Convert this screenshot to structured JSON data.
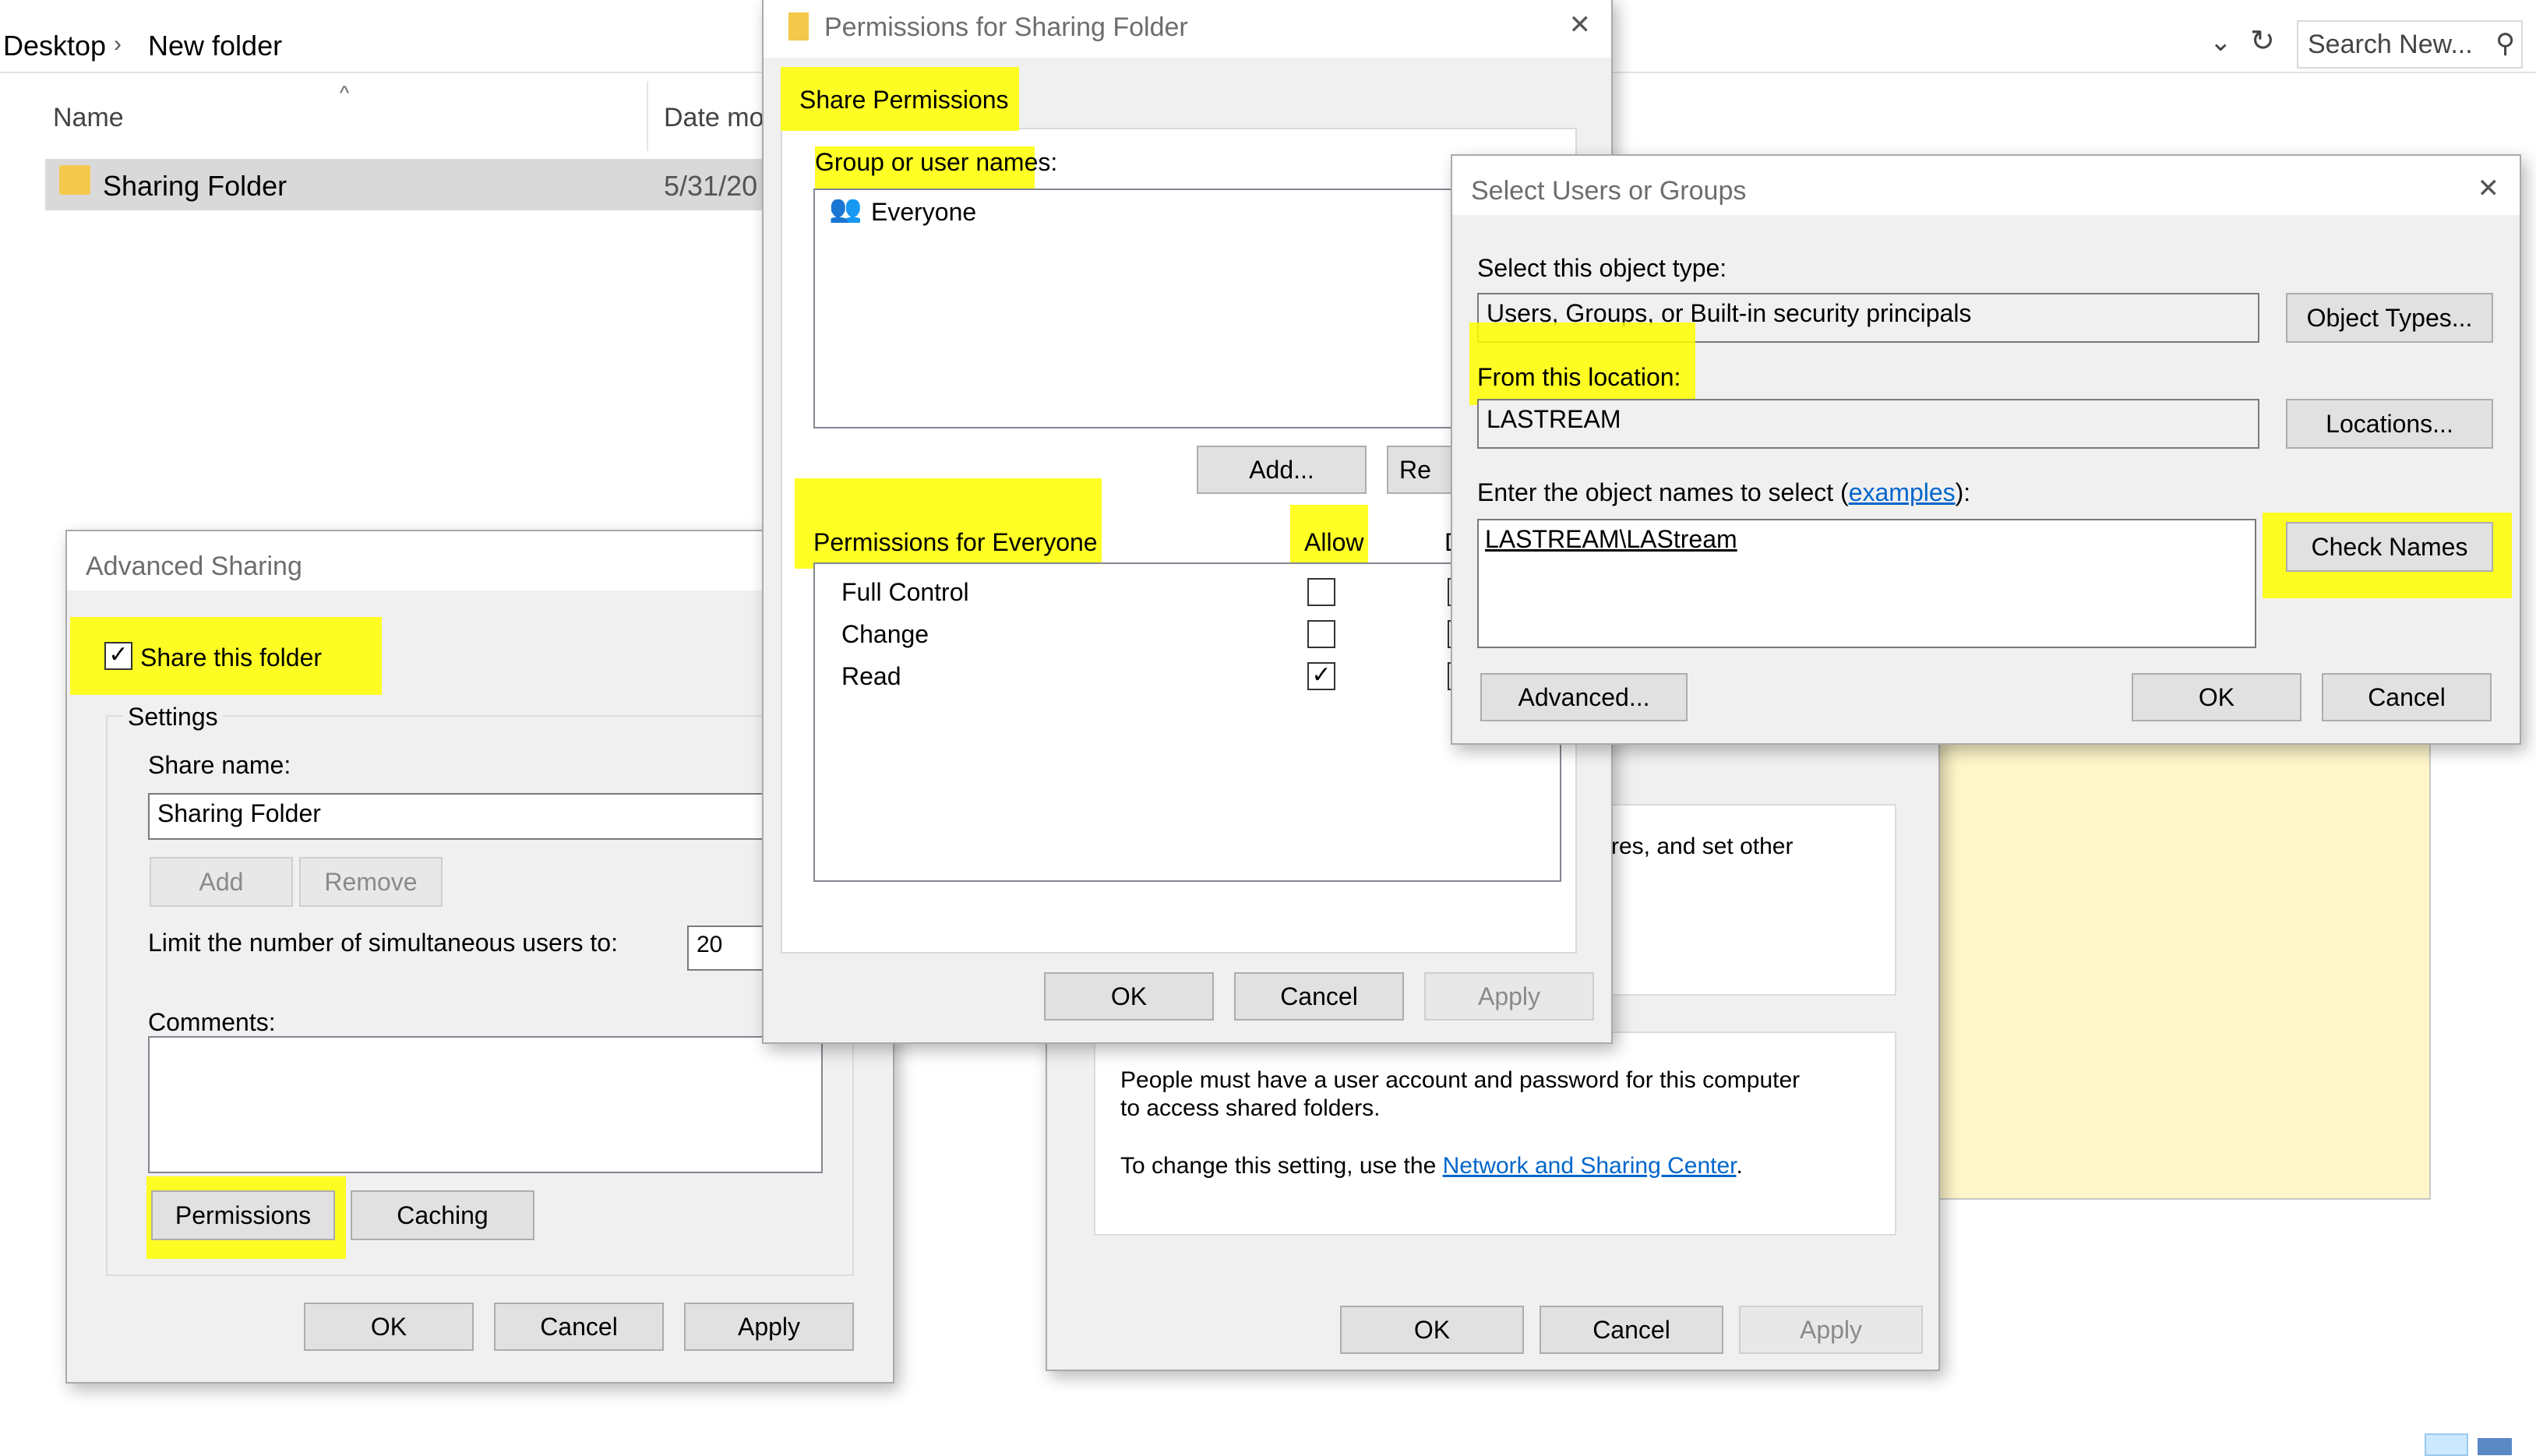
{
  "explorer": {
    "breadcrumb": [
      "Desktop",
      "New folder"
    ],
    "search_placeholder": "Search New...",
    "columns": {
      "name": "Name",
      "date": "Date mo"
    },
    "row": {
      "name": "Sharing Folder",
      "date": "5/31/20"
    }
  },
  "advanced_sharing": {
    "title": "Advanced Sharing",
    "share_label": "Share this folder",
    "settings_label": "Settings",
    "share_name_label": "Share name:",
    "share_name_value": "Sharing Folder",
    "add": "Add",
    "remove": "Remove",
    "limit_label": "Limit the number of simultaneous users to:",
    "limit_value": "20",
    "comments_label": "Comments:",
    "permissions": "Permissions",
    "caching": "Caching",
    "ok": "OK",
    "cancel": "Cancel",
    "apply": "Apply"
  },
  "properties": {
    "partial_text": "res, and set other",
    "password_text_1": "People must have a user account and password for this computer",
    "password_text_2": "to access shared folders.",
    "change_text": "To change this setting, use the ",
    "change_link": "Network and Sharing Center",
    "change_end": ".",
    "ok": "OK",
    "cancel": "Cancel",
    "apply": "Apply"
  },
  "permissions": {
    "title": "Permissions for Sharing Folder",
    "tab": "Share Permissions",
    "group_label": "Group or user names:",
    "group_item": "Everyone",
    "add": "Add...",
    "remove_partial": "Re",
    "perm_label": "Permissions for Everyone",
    "allow": "Allow",
    "deny_partial": "D",
    "rows": [
      {
        "name": "Full Control",
        "allow": ""
      },
      {
        "name": "Change",
        "allow": ""
      },
      {
        "name": "Read",
        "allow": "✓"
      }
    ],
    "ok": "OK",
    "cancel": "Cancel",
    "apply": "Apply"
  },
  "select_users": {
    "title": "Select Users or Groups",
    "object_type_label": "Select this object type:",
    "object_type_value": "Users, Groups, or Built-in security principals",
    "object_types_btn": "Object Types...",
    "location_label": "From this location:",
    "location_value": "LASTREAM",
    "locations_btn": "Locations...",
    "names_label": "Enter the object names to select (",
    "examples_link": "examples",
    "names_label_end": "):",
    "names_value": "LASTREAM\\LAStream",
    "check_names": "Check Names",
    "advanced": "Advanced...",
    "ok": "OK",
    "cancel": "Cancel"
  },
  "colors": {
    "highlight": "#ffff00",
    "link": "#0066cc",
    "note": "#fff6c9"
  }
}
